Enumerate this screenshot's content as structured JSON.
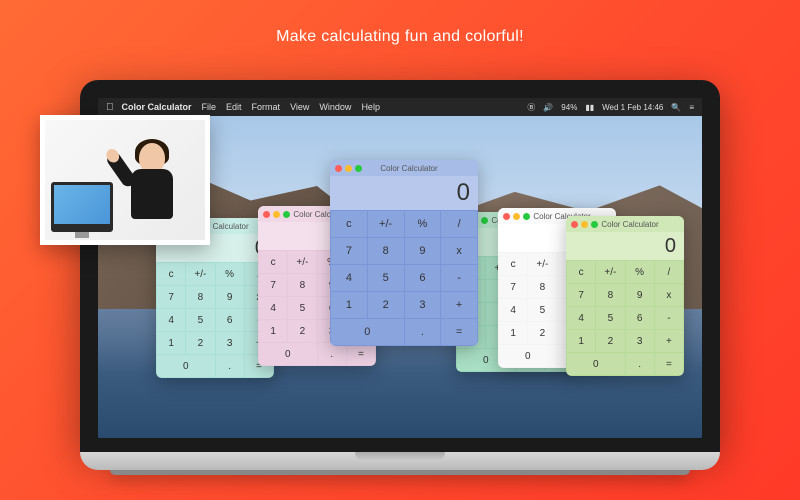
{
  "tagline": "Make calculating fun and colorful!",
  "menubar": {
    "app": "Color Calculator",
    "items": [
      "File",
      "Edit",
      "Format",
      "View",
      "Window",
      "Help"
    ],
    "right": {
      "battery": "94%",
      "datetime": "Wed 1 Feb 14:46"
    }
  },
  "calc_title": "Color Calculator",
  "display_value": "0",
  "buttons": {
    "clear": "c",
    "sign": "+/-",
    "percent": "%",
    "divide": "/",
    "multiply": "x",
    "minus": "-",
    "plus": "+",
    "equals": "=",
    "decimal": ".",
    "n0": "0",
    "n1": "1",
    "n2": "2",
    "n3": "3",
    "n4": "4",
    "n5": "5",
    "n6": "6",
    "n7": "7",
    "n8": "8",
    "n9": "9"
  },
  "calculators": [
    {
      "id": "c1",
      "theme": "teal"
    },
    {
      "id": "c2",
      "theme": "pink"
    },
    {
      "id": "c3",
      "theme": "blue"
    },
    {
      "id": "c4",
      "theme": "mint"
    },
    {
      "id": "c5",
      "theme": "white"
    },
    {
      "id": "c6",
      "theme": "green"
    }
  ]
}
